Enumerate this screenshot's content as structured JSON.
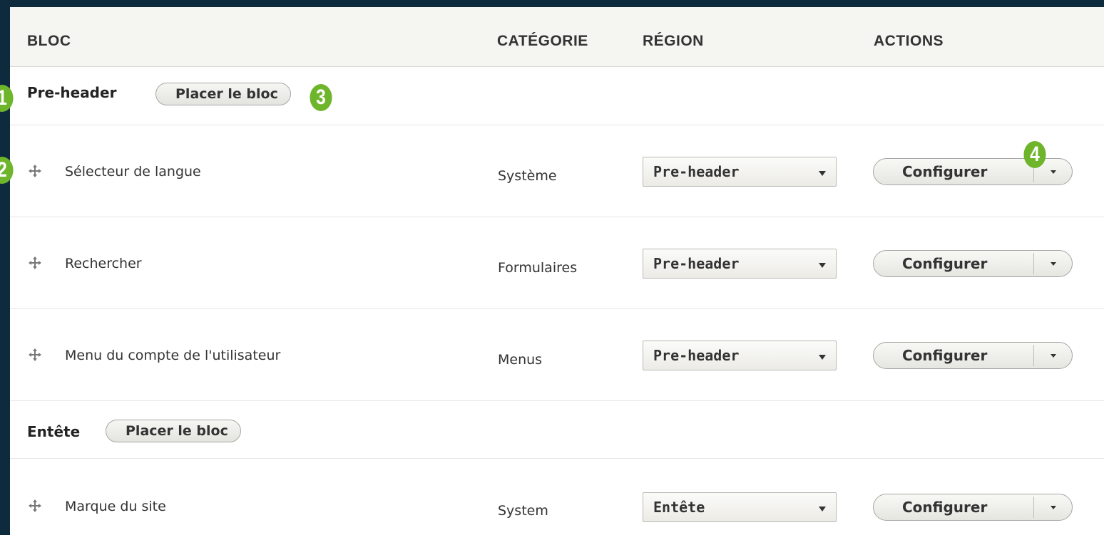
{
  "table": {
    "headers": {
      "block": "BLOC",
      "category": "CATÉGORIE",
      "region": "RÉGION",
      "actions": "ACTIONS"
    },
    "regions": [
      {
        "title": "Pre-header",
        "place_button": "Placer le bloc",
        "rows": [
          {
            "name": "Sélecteur de langue",
            "category": "Système",
            "region": "Pre-header",
            "action": "Configurer"
          },
          {
            "name": "Rechercher",
            "category": "Formulaires",
            "region": "Pre-header",
            "action": "Configurer"
          },
          {
            "name": "Menu du compte de l'utilisateur",
            "category": "Menus",
            "region": "Pre-header",
            "action": "Configurer"
          }
        ]
      },
      {
        "title": "Entête",
        "place_button": "Placer le bloc",
        "rows": [
          {
            "name": "Marque du site",
            "category": "System",
            "region": "Entête",
            "action": "Configurer"
          }
        ]
      }
    ]
  },
  "callouts": [
    "1",
    "2",
    "3",
    "4"
  ],
  "colors": {
    "background": "#0e2a3d",
    "callout": "#6fb52c",
    "header_bg": "#f5f5f2"
  },
  "icons": {
    "drag_handle": "move-arrows-icon",
    "dropdown": "caret-down-icon"
  }
}
